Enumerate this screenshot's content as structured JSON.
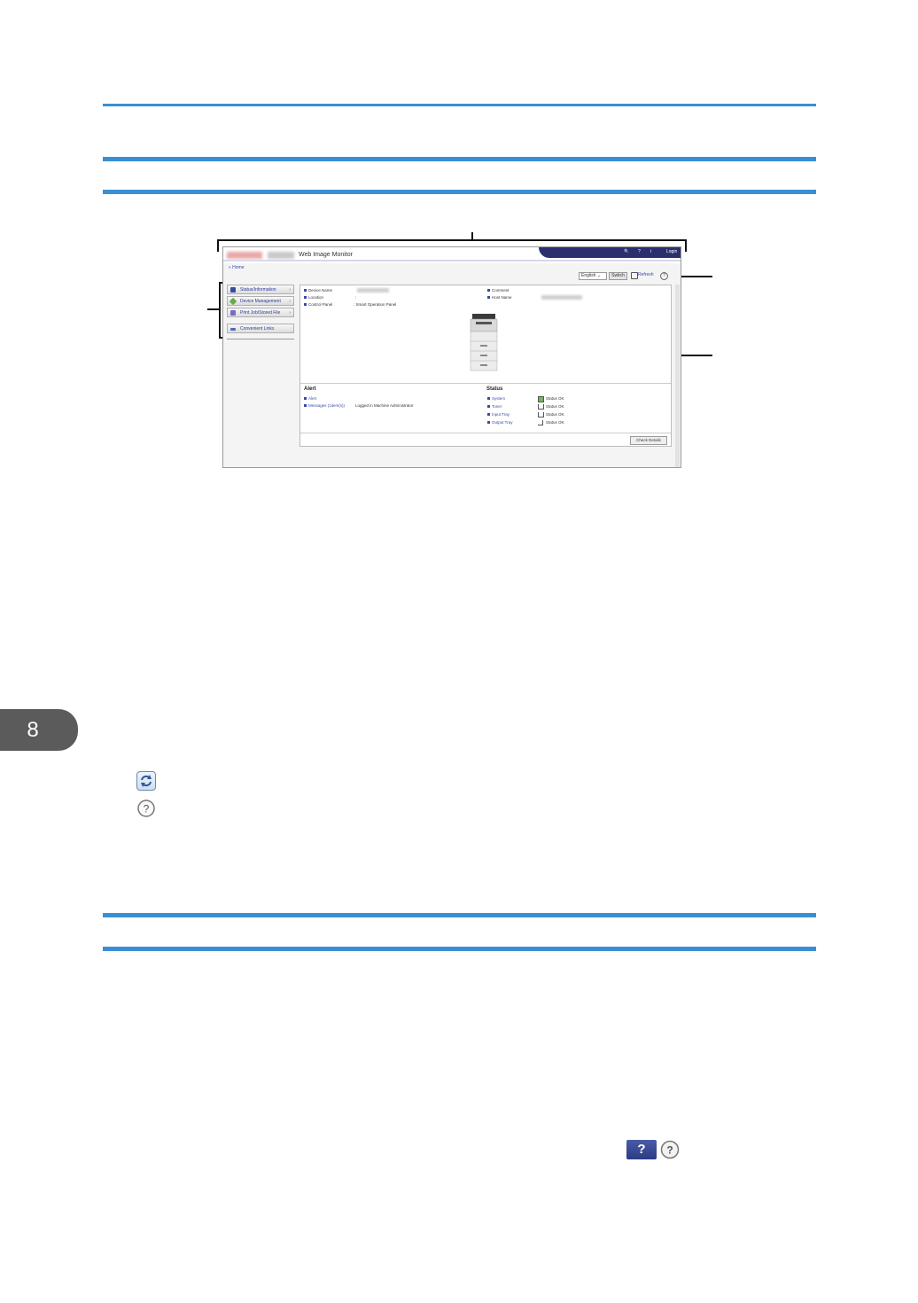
{
  "chapter": {
    "number": "8"
  },
  "screenshot": {
    "app_title": "Web Image Monitor",
    "nav": {
      "search": "🔍",
      "help": "?",
      "info": "i",
      "login": "Login"
    },
    "breadcrumb": "« Home",
    "language_selected": "English",
    "switch_label": "Switch",
    "refresh_label": "Refresh",
    "menu": [
      {
        "label": "Status/Information"
      },
      {
        "label": "Device Management"
      },
      {
        "label": "Print Job/Stored File"
      },
      {
        "label": "Convenient Links"
      }
    ],
    "info": {
      "device_name_label": "Device Name",
      "location_label": "Location",
      "control_panel_label": "Control Panel",
      "control_panel_value": ": Smart Operation Panel",
      "comment_label": "Comment",
      "host_name_label": "Host Name"
    },
    "alert": {
      "heading": "Alert",
      "alert_link": "Alert",
      "messages_link": "Messages (1item(s))",
      "messages_value": "Logged in Machine Administrator"
    },
    "status": {
      "heading": "Status",
      "rows": [
        {
          "label": "System",
          "value": "Status OK"
        },
        {
          "label": "Toner",
          "value": "Status OK"
        },
        {
          "label": "Input Tray",
          "value": "Status OK"
        },
        {
          "label": "Output Tray",
          "value": "Status OK"
        }
      ]
    },
    "check_details_label": "Check Details"
  },
  "icons": {
    "refresh": "refresh-icon",
    "help": "help-icon",
    "help_button": "?"
  },
  "colors": {
    "rule": "#3a8fd4",
    "chapter_tab": "#5b5b5b",
    "nav_band": "#2b2f6e"
  }
}
